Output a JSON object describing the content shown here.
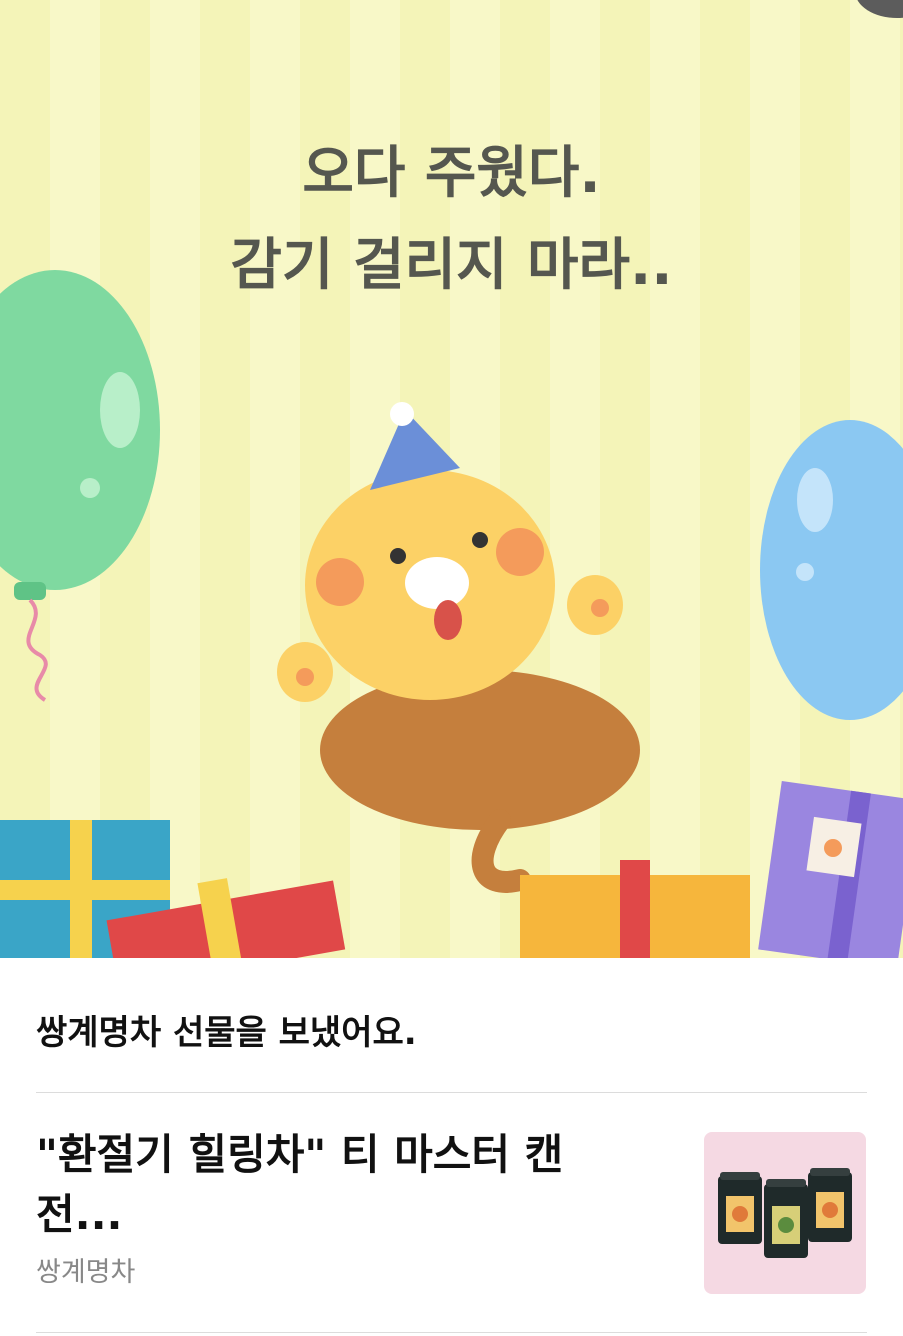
{
  "card": {
    "headline_line1": "오다 주웠다.",
    "headline_line2": "감기 걸리지 마라.."
  },
  "gift": {
    "message": "쌍계명차 선물을 보냈어요.",
    "product_title": "\"환절기 힐링차\" 티 마스터 캔 전...",
    "brand": "쌍계명차"
  },
  "icons": {
    "close": "close-corner-icon",
    "product_image": "tea-cans-image"
  },
  "colors": {
    "stripe_light": "#f8f8c8",
    "stripe_dark": "#f4f4b8",
    "headline_text": "#55574f",
    "brand_text": "#888888",
    "divider": "#dcdcdc"
  }
}
